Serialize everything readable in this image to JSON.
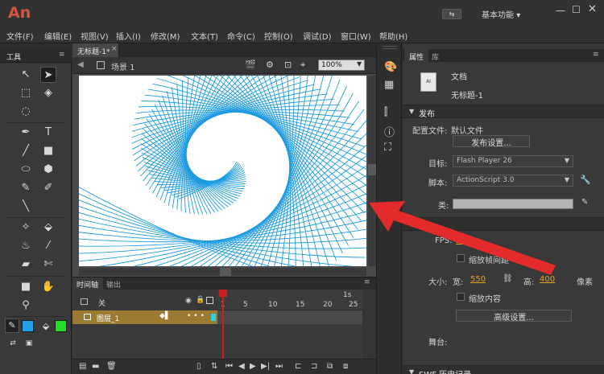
{
  "app": {
    "logo": "An",
    "workspace": "基本功能",
    "workspace_caret": "▾"
  },
  "menu": [
    "文件(F)",
    "编辑(E)",
    "视图(V)",
    "插入(I)",
    "修改(M)",
    "文本(T)",
    "命令(C)",
    "控制(O)",
    "调试(D)",
    "窗口(W)",
    "帮助(H)"
  ],
  "tools": {
    "title": "工具"
  },
  "document": {
    "tab": "无标题-1*",
    "scene": "场景 1",
    "zoom": "100%"
  },
  "timeline": {
    "tab": "时间轴",
    "output_tab": "输出",
    "folder_label": "关",
    "layer_name": "图层_1",
    "ruler_top": "1s",
    "ruler_ticks": [
      "1",
      "5",
      "10",
      "15",
      "20",
      "25"
    ],
    "playhead_color": "#cf2020",
    "layer_color": "#9b7a32"
  },
  "properties": {
    "tab": "属性",
    "library_tab": "库",
    "doc_type": "文档",
    "doc_name": "无标题-1",
    "publish_section": "发布",
    "profile_label": "配置文件:",
    "profile_value": "默认文件",
    "publish_settings_button": "发布设置...",
    "target_label": "目标:",
    "target_value": "Flash Player 26",
    "script_label": "脚本:",
    "script_value": "ActionScript 3.0",
    "class_label": "类:",
    "fps_label": "FPS:",
    "fps_value": "24.0",
    "scale_spans": "缩放帧间距",
    "size_label": "大小:",
    "width_label": "宽:",
    "width_value": "550",
    "height_label": "高:",
    "height_value": "400",
    "pixel_unit": "像素",
    "scale_content": "缩放内容",
    "advanced_button": "高级设置...",
    "stage_label": "舞台:",
    "swf_section": "SWF 历史记录"
  },
  "colors": {
    "accent": "#e6a21e",
    "stroke": "#1fa0e8",
    "fill": "#22dd22",
    "arrow": "#e32b2b",
    "drawing": "#1e9be0"
  }
}
